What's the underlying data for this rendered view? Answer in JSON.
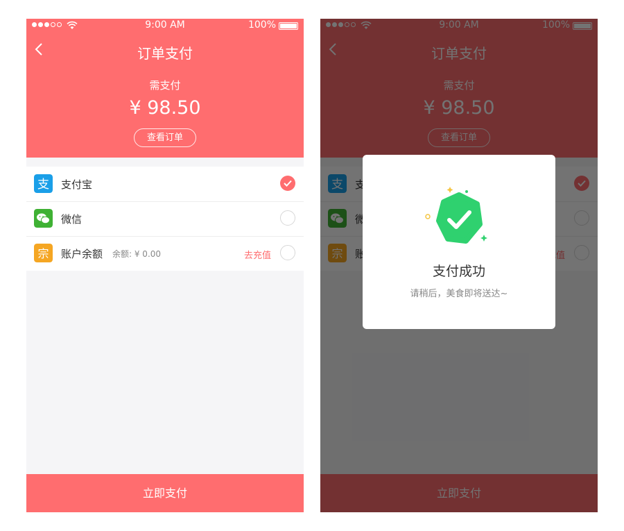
{
  "status_bar": {
    "time": "9:00 AM",
    "battery": "100%"
  },
  "page": {
    "title": "订单支付",
    "need_pay_label": "需支付",
    "amount": "¥ 98.50",
    "view_order_button": "查看订单"
  },
  "payment_methods": [
    {
      "label": "支付宝",
      "icon": "alipay-icon",
      "selected": true
    },
    {
      "label": "微信",
      "icon": "wechat-icon",
      "selected": false
    },
    {
      "label": "账户余额",
      "icon": "wallet-icon",
      "balance": "余额: ¥ 0.00",
      "recharge_label": "去充值",
      "selected": false
    }
  ],
  "pay_button": "立即支付",
  "success_dialog": {
    "title": "支付成功",
    "message": "请稍后，美食即将送达~",
    "icon": "success-check-icon"
  },
  "colors": {
    "brand": "#ff6d6f",
    "alipay": "#1a9fe8",
    "wechat": "#3fb134",
    "wallet": "#f5a623",
    "success": "#2fd16f"
  }
}
